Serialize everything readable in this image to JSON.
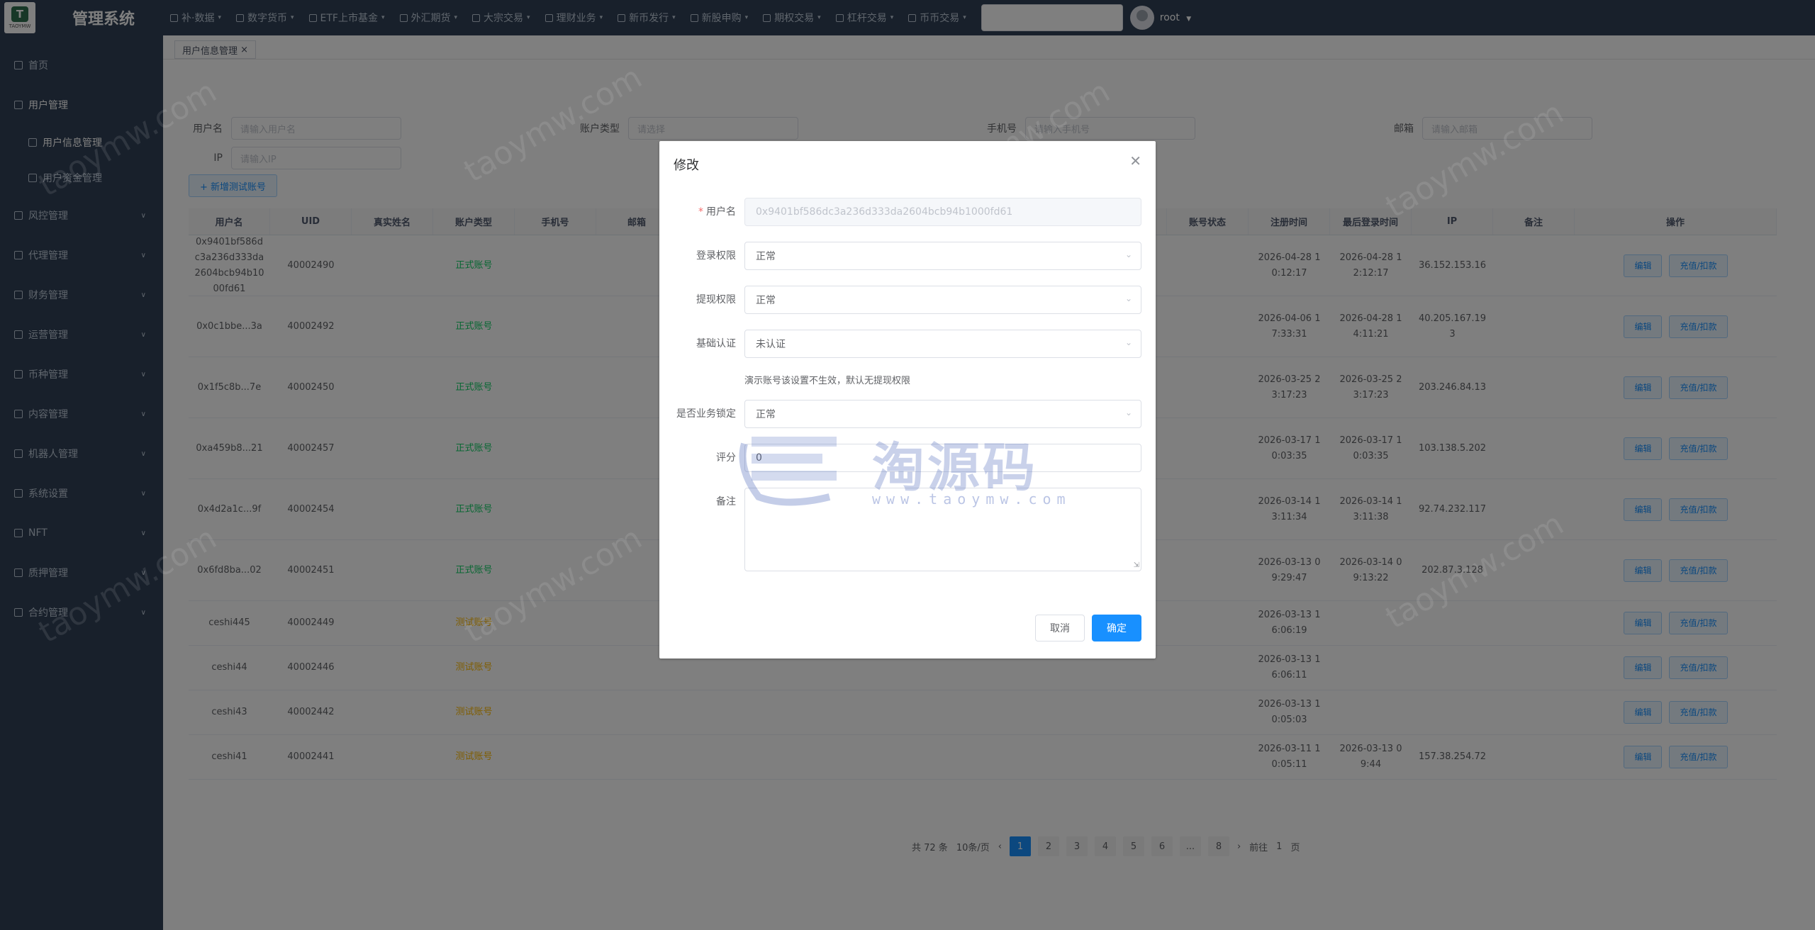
{
  "app": {
    "title": "管理系统",
    "logo_text": "TAOYMW",
    "nav": [
      "补·数据",
      "数字货币",
      "ETF上市基金",
      "外汇期货",
      "大宗交易",
      "理财业务",
      "新币发行",
      "新股申购",
      "期权交易",
      "杠杆交易",
      "币币交易"
    ],
    "search_placeholder": "",
    "user": "root"
  },
  "sidebar": {
    "items": [
      {
        "label": "首页",
        "level": 1
      },
      {
        "label": "用户管理",
        "level": 1,
        "active": true
      },
      {
        "label": "用户信息管理",
        "level": 2,
        "active": true
      },
      {
        "label": "用户资金管理",
        "level": 2
      },
      {
        "label": "风控管理",
        "level": 1,
        "arrow": true
      },
      {
        "label": "代理管理",
        "level": 1,
        "arrow": true
      },
      {
        "label": "财务管理",
        "level": 1,
        "arrow": true
      },
      {
        "label": "运营管理",
        "level": 1,
        "arrow": true
      },
      {
        "label": "币种管理",
        "level": 1,
        "arrow": true
      },
      {
        "label": "内容管理",
        "level": 1,
        "arrow": true
      },
      {
        "label": "机器人管理",
        "level": 1,
        "arrow": true
      },
      {
        "label": "系统设置",
        "level": 1,
        "arrow": true
      },
      {
        "label": "NFT",
        "level": 1,
        "arrow": true
      },
      {
        "label": "质押管理",
        "level": 1,
        "arrow": true
      },
      {
        "label": "合约管理",
        "level": 1,
        "arrow": true
      }
    ]
  },
  "main": {
    "tab": "用户信息管理",
    "filters": {
      "row1": [
        {
          "label": "用户名",
          "placeholder": "请输入用户名"
        },
        {
          "label": "账户类型",
          "placeholder": "请选择"
        },
        {
          "label": "手机号",
          "placeholder": "请输入手机号"
        },
        {
          "label": "邮箱",
          "placeholder": "请输入邮箱"
        }
      ],
      "row2": [
        {
          "label": "IP",
          "placeholder": "请输入IP"
        }
      ]
    },
    "add_button": "+ 新增测试账号",
    "columns": [
      "用户名",
      "UID",
      "真实姓名",
      "账户类型",
      "手机号",
      "邮箱",
      "",
      "",
      "",
      "",
      "",
      "",
      "账号状态",
      "注册时间",
      "最后登录时间",
      "IP",
      "备注",
      "操作"
    ],
    "rows": [
      {
        "user": "0x9401bf586dc3a236d333da2604bcb94b1000fd61",
        "uid": "40002490",
        "type": "正式账号",
        "reg": "2026-04-28 10:12:17",
        "last": "2026-04-28 12:12:17",
        "ip": "36.152.153.16"
      },
      {
        "user": "0x0c1bbe...3a",
        "uid": "40002492",
        "type": "正式账号",
        "reg": "2026-04-06 17:33:31",
        "last": "2026-04-28 14:11:21",
        "ip": "40.205.167.193"
      },
      {
        "user": "0x1f5c8b...7e",
        "uid": "40002450",
        "type": "正式账号",
        "reg": "2026-03-25 23:17:23",
        "last": "2026-03-25 23:17:23",
        "ip": "203.246.84.13"
      },
      {
        "user": "0xa459b8...21",
        "uid": "40002457",
        "type": "正式账号",
        "reg": "2026-03-17 10:03:35",
        "last": "2026-03-17 10:03:35",
        "ip": "103.138.5.202"
      },
      {
        "user": "0x4d2a1c...9f",
        "uid": "40002454",
        "type": "正式账号",
        "reg": "2026-03-14 13:11:34",
        "last": "2026-03-14 13:11:38",
        "ip": "92.74.232.117"
      },
      {
        "user": "0x6fd8ba...02",
        "uid": "40002451",
        "type": "正式账号",
        "reg": "2026-03-13 09:29:47",
        "last": "2026-03-14 09:13:22",
        "ip": "202.87.3.128"
      },
      {
        "user": "ceshi445",
        "uid": "40002449",
        "type": "测试账号",
        "reg": "2026-03-13 16:06:19",
        "last": "",
        "ip": "",
        "short": true
      },
      {
        "user": "ceshi44",
        "uid": "40002446",
        "type": "测试账号",
        "reg": "2026-03-13 16:06:11",
        "last": "",
        "ip": "",
        "short": true
      },
      {
        "user": "ceshi43",
        "uid": "40002442",
        "type": "测试账号",
        "reg": "2026-03-13 10:05:03",
        "last": "",
        "ip": "",
        "short": true
      },
      {
        "user": "ceshi41",
        "uid": "40002441",
        "type": "测试账号",
        "reg": "2026-03-11 10:05:11",
        "last": "2026-03-13 09:44",
        "ip": "157.38.254.72",
        "short": true
      }
    ],
    "op_edit": "编辑",
    "op_other": "充值/扣款",
    "pager": {
      "total": "共 72 条",
      "size": "10条/页",
      "pages": [
        "1",
        "2",
        "3",
        "4",
        "5",
        "6",
        "...",
        "8"
      ],
      "goto": "前往",
      "goto_value": "1",
      "goto_unit": "页"
    }
  },
  "dialog": {
    "title": "修改",
    "close_icon": "close-icon",
    "fields": {
      "username": {
        "label": "用户名",
        "value": "0x9401bf586dc3a236d333da2604bcb94b1000fd61"
      },
      "login_perm": {
        "label": "登录权限",
        "value": "正常"
      },
      "withdraw_perm": {
        "label": "提现权限",
        "value": "正常"
      },
      "basic_auth": {
        "label": "基础认证",
        "value": "未认证"
      },
      "hint": "演示账号该设置不生效，默认无提现权限",
      "biz_lock": {
        "label": "是否业务锁定",
        "value": "正常"
      },
      "score": {
        "label": "评分",
        "value": "0"
      },
      "remark": {
        "label": "备注",
        "value": ""
      }
    },
    "cancel": "取消",
    "confirm": "确定"
  },
  "watermark": {
    "repeat": "taoymw.com",
    "stamp_title": "淘源码",
    "stamp_sub": "www.taoymw.com"
  },
  "colors": {
    "sidebar_bg": "#304156",
    "primary": "#1890ff",
    "overlay": "rgba(0,0,0,0.5)"
  }
}
